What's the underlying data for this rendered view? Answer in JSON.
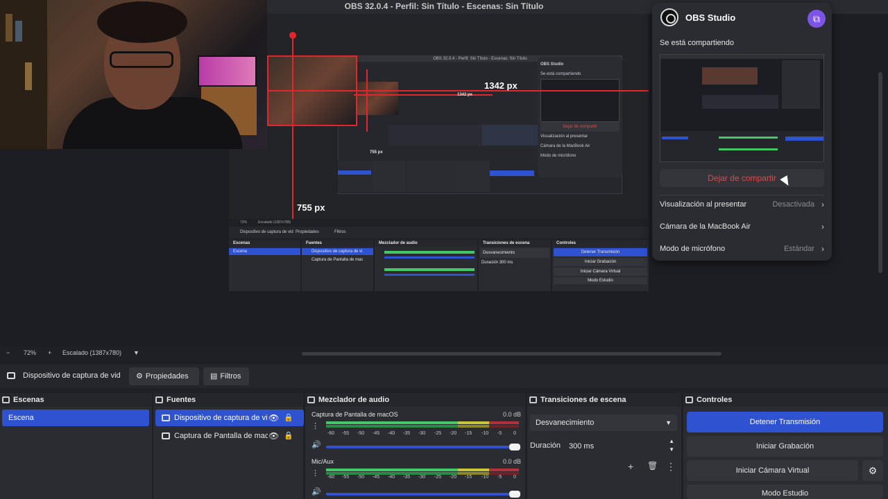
{
  "window": {
    "title": "OBS 32.0.4 - Perfil: Sin Título - Escenas: Sin Título"
  },
  "preview": {
    "measure_width": "1342 px",
    "measure_height": "755 px",
    "nested_title": "OBS 32.0.4 - Perfil: Sin Título - Escenas: Sin Título",
    "nested_app": "OBS Studio",
    "nested_sharing": "Se está compartiendo",
    "nested_stop": "Dejar de compartir",
    "nested_rows": [
      "Visualización al presentar",
      "Cámara de la MacBook Air",
      "Modo de micrófono"
    ],
    "nested_measure_w": "1342 px",
    "nested_measure_h": "755 px",
    "nested_zoom": "72%",
    "nested_scaled": "Escalado (1387x780)",
    "nested_source": "Dispositivo de captura de vid",
    "nested_props": "Propiedades",
    "nested_filters": "Filtros",
    "nested_docks": [
      "Escenas",
      "Fuentes",
      "Mezclador de audio",
      "Transiciones de escena",
      "Controles"
    ],
    "nested_scene": "Escena",
    "nested_src1": "Dispositivo de captura de vi",
    "nested_src2": "Captura de Pantalla de mac",
    "nested_trans": "Desvanecimiento",
    "nested_dur_label": "Duración",
    "nested_dur": "300 ms",
    "nested_ctrl": [
      "Detener Transmisión",
      "Iniciar Grabación",
      "Iniciar Cámara Virtual",
      "Modo Estudio"
    ]
  },
  "share_popup": {
    "app_name": "OBS Studio",
    "sharing_label": "Se está compartiendo",
    "stop_button": "Dejar de compartir",
    "rows": [
      {
        "label": "Visualización al presentar",
        "value": "Desactivada"
      },
      {
        "label": "Cámara de la MacBook Air",
        "value": ""
      },
      {
        "label": "Modo de micrófono",
        "value": "Estándar"
      }
    ]
  },
  "zoom_bar": {
    "minus": "−",
    "zoom": "72%",
    "plus": "+",
    "scaled": "Escalado (1387x780)",
    "dropdown": "▼"
  },
  "source_toolbar": {
    "source_name": "Dispositivo de captura de vid",
    "properties": "Propiedades",
    "filters": "Filtros"
  },
  "docks": {
    "scenes": {
      "title": "Escenas",
      "items": [
        "Escena"
      ]
    },
    "sources": {
      "title": "Fuentes",
      "items": [
        "Dispositivo de captura de vi",
        "Captura de Pantalla de mac"
      ]
    },
    "mixer": {
      "title": "Mezclador de audio",
      "channels": [
        {
          "name": "Captura de Pantalla de macOS",
          "db": "0.0 dB",
          "level": 1.0
        },
        {
          "name": "Mic/Aux",
          "db": "0.0 dB",
          "level": 1.0
        }
      ],
      "scale": [
        "-60",
        "-55",
        "-50",
        "-45",
        "-40",
        "-35",
        "-30",
        "-25",
        "-20",
        "-15",
        "-10",
        "-5",
        "0"
      ]
    },
    "transitions": {
      "title": "Transiciones de escena",
      "selected": "Desvanecimiento",
      "duration_label": "Duración",
      "duration": "300 ms"
    },
    "controls": {
      "title": "Controles",
      "buttons": [
        "Detener Transmisión",
        "Iniciar Grabación",
        "Iniciar Cámara Virtual",
        "Modo Estudio"
      ]
    }
  },
  "colors": {
    "accent": "#2f53d0",
    "measure_red": "#e2262c",
    "stop_red": "#e0484b",
    "share_purple": "#7d55e6"
  }
}
